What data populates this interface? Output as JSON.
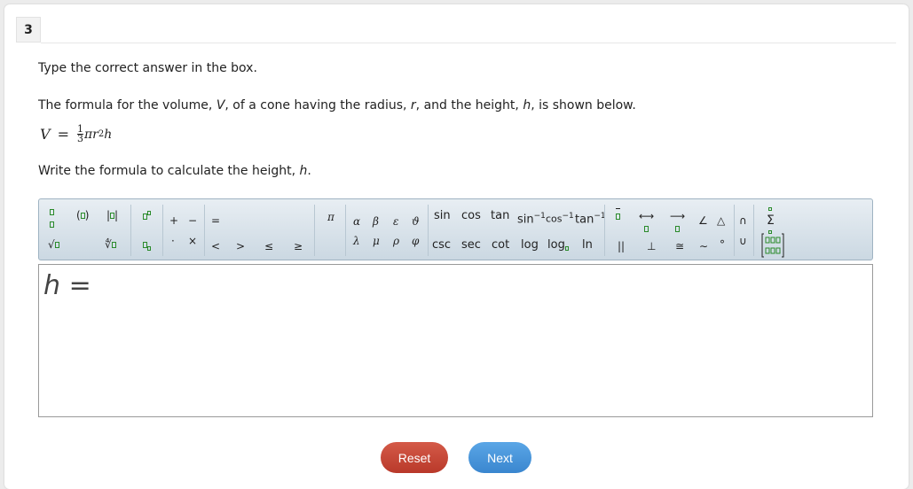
{
  "question": {
    "number": "3",
    "instruction": "Type the correct answer in the box.",
    "stem_parts": [
      "The formula for the volume, ",
      "V",
      ", of a cone having the radius, ",
      "r",
      ", and the height, ",
      "h",
      ", is shown below."
    ],
    "formula": {
      "lhs": "V",
      "eq": "=",
      "num": "1",
      "den": "3",
      "rest": "πr",
      "exp": "2",
      "tail": "h"
    },
    "prompt_parts": [
      "Write the formula to calculate the height, ",
      "h",
      "."
    ]
  },
  "toolbar": {
    "funcs_top": [
      "sin",
      "cos",
      "tan",
      "sin",
      "cos",
      "tan"
    ],
    "funcs_bottom": [
      "csc",
      "sec",
      "cot",
      "log",
      "log",
      "ln"
    ],
    "inverse_exp": "−1",
    "ops_top": [
      "+",
      "−"
    ],
    "ops_bottom": [
      "·",
      "×"
    ],
    "equals": "=",
    "relations": [
      "<",
      ">",
      "≤",
      "≥"
    ],
    "pi": "π",
    "greek_top": [
      "α",
      "β",
      "ε",
      "ϑ"
    ],
    "greek_bottom": [
      "λ",
      "μ",
      "ρ",
      "φ"
    ],
    "geo_top": [
      "∠",
      "△"
    ],
    "geo_bottom": [
      "||",
      "⊥",
      "≅",
      "∼",
      "°"
    ],
    "sets": [
      "∩",
      "∪"
    ],
    "sum": "Σ"
  },
  "answer": {
    "lhs": "h",
    "eq": "="
  },
  "buttons": {
    "reset": "Reset",
    "next": "Next"
  }
}
